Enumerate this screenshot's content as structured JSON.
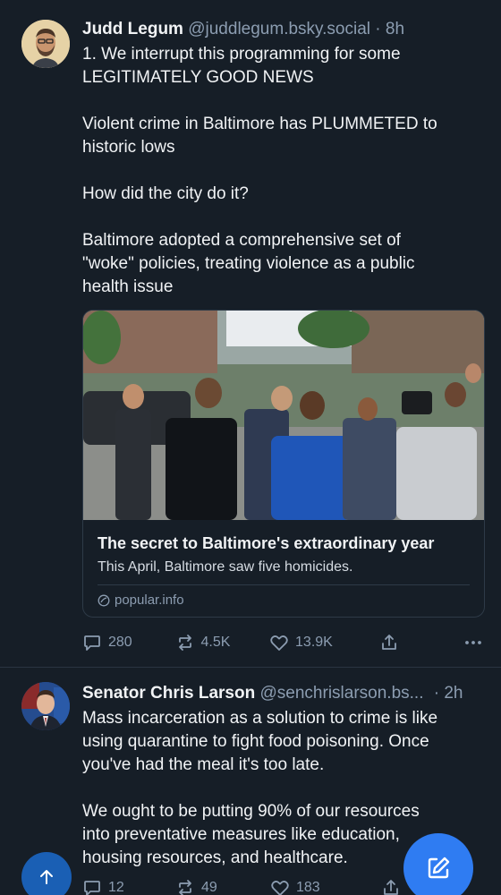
{
  "posts": [
    {
      "author_name": "Judd Legum",
      "handle": "@juddlegum.bsky.social",
      "separator": "·",
      "time": "8h",
      "paragraphs": [
        "1. We interrupt this programming for some\nLEGITIMATELY GOOD NEWS",
        "Violent crime in Baltimore has PLUMMETED to\nhistoric lows",
        "How did the city do it?",
        "Baltimore adopted a comprehensive set of\n\"woke\" policies, treating violence as a public\nhealth issue"
      ],
      "link_card": {
        "title": "The secret to Baltimore's extraordinary year",
        "description": "This April, Baltimore saw five homicides.",
        "domain": "popular.info"
      },
      "stats": {
        "replies": "280",
        "reposts": "4.5K",
        "likes": "13.9K"
      }
    },
    {
      "author_name": "Senator Chris Larson",
      "handle": "@senchrislarson.bs...",
      "separator": "·",
      "time": "2h",
      "paragraphs": [
        "Mass incarceration as a solution to crime is like\nusing quarantine to fight food poisoning. Once\nyou've had the meal it's too late.",
        "We ought to be putting 90% of our resources\ninto preventative measures like education,\nhousing resources, and healthcare."
      ],
      "stats": {
        "replies": "12",
        "reposts": "49",
        "likes": "183"
      }
    }
  ],
  "icons": {
    "reply": "speech-bubble-icon",
    "repost": "repost-arrows-icon",
    "like": "heart-icon",
    "share": "share-upload-icon",
    "more": "ellipsis-icon",
    "domain": "globe-icon",
    "scroll_top": "arrow-up-icon",
    "compose": "compose-pencil-icon"
  },
  "colors": {
    "background": "#161e27",
    "muted_text": "#8c9db1",
    "accent": "#2f7cf2"
  }
}
